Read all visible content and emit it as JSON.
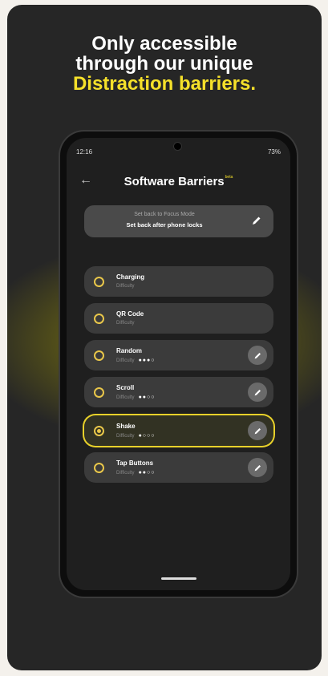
{
  "headline": {
    "line1": "Only accessible",
    "line2": "through our unique",
    "line3": "Distraction barriers."
  },
  "status_bar": {
    "time": "12:16",
    "right": "73%"
  },
  "app": {
    "title": "Software Barriers",
    "beta_badge": "beta",
    "set_back": {
      "line1": "Set back to Focus Mode",
      "line2": "Set back after phone locks"
    }
  },
  "barriers": [
    {
      "name": "Charging",
      "difficulty_label": "Difficulty",
      "dots": "",
      "selected": false,
      "editable": false
    },
    {
      "name": "QR Code",
      "difficulty_label": "Difficulty",
      "dots": "",
      "selected": false,
      "editable": false
    },
    {
      "name": "Random",
      "difficulty_label": "Difficulty",
      "dots": "●●●○",
      "selected": false,
      "editable": true
    },
    {
      "name": "Scroll",
      "difficulty_label": "Difficulty",
      "dots": "●●○○",
      "selected": false,
      "editable": true
    },
    {
      "name": "Shake",
      "difficulty_label": "Difficulty",
      "dots": "●○○○",
      "selected": true,
      "editable": true
    },
    {
      "name": "Tap Buttons",
      "difficulty_label": "Difficulty",
      "dots": "●●○○",
      "selected": false,
      "editable": true
    }
  ],
  "colors": {
    "accent": "#f5e02a",
    "background": "#262626"
  }
}
